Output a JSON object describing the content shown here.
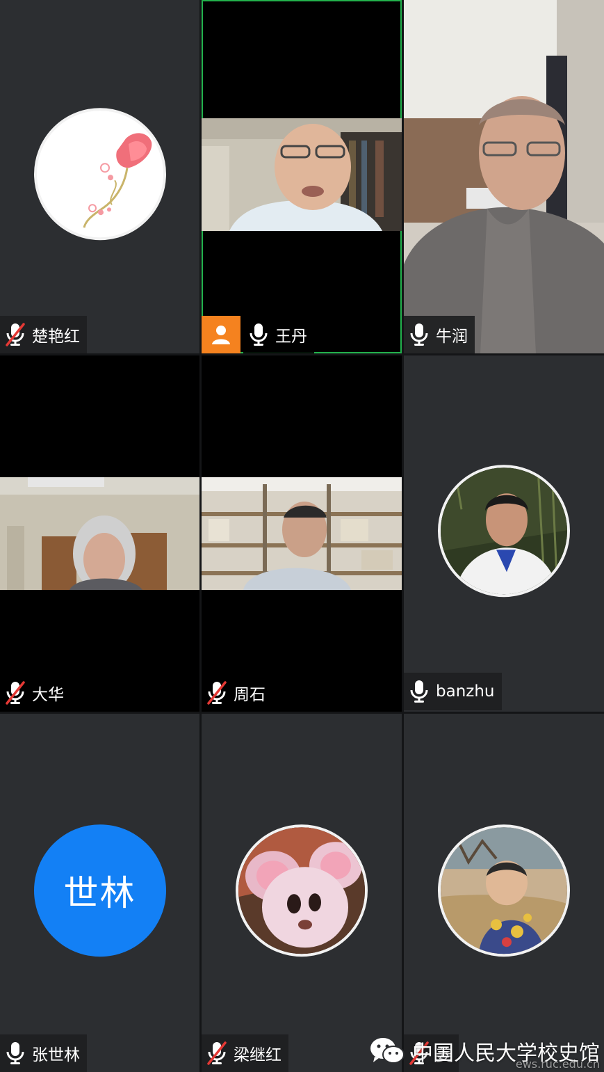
{
  "participants": [
    {
      "name": "楚艳红",
      "muted": true
    },
    {
      "name": "王丹",
      "muted": false,
      "host": true
    },
    {
      "name": "牛润",
      "muted": false
    },
    {
      "name": "大华",
      "muted": true
    },
    {
      "name": "周石",
      "muted": true
    },
    {
      "name": "banzhu",
      "muted": false
    },
    {
      "name": "张世林",
      "muted": false,
      "initials": "世林"
    },
    {
      "name": "梁继红",
      "muted": true
    },
    {
      "name": "姜",
      "muted": true
    }
  ],
  "watermark": {
    "title": "中国人民大学校史馆",
    "url": "ews.ruc.edu.cn"
  },
  "colors": {
    "tile_bg": "#2c2e31",
    "active_border": "#22b14c",
    "host_badge": "#f5821f",
    "avatar_blue": "#1380f5",
    "muted_red": "#e53935"
  }
}
